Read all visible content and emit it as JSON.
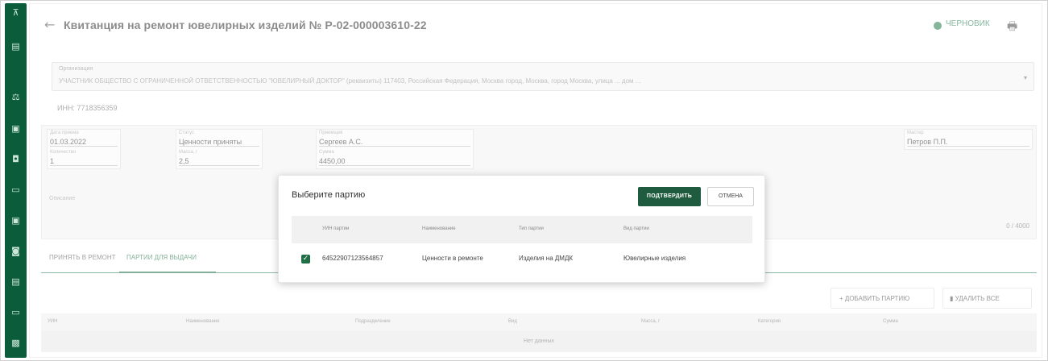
{
  "rail": {
    "icons": [
      "filter-icon",
      "list-icon",
      "scale-icon",
      "doc-icon",
      "box-icon",
      "folder-icon",
      "file-icon",
      "briefcase-icon",
      "table-icon",
      "window-icon",
      "card-icon"
    ],
    "glyphs": [
      "⊼",
      "▤",
      "⚖",
      "▣",
      "◘",
      "▭",
      "▣",
      "◙",
      "▤",
      "▭",
      "▩"
    ]
  },
  "header": {
    "back_glyph": "←",
    "title": "Квитанция на ремонт ювелирных изделий № Р-02-000003610-22",
    "status": "ЧЕРНОВИК",
    "status_color": "#1f7a4c",
    "print_glyph": "🖶"
  },
  "org": {
    "label": "Организация",
    "value": "УЧАСТНИК ОБЩЕСТВО С ОГРАНИЧЕННОЙ ОТВЕТСТВЕННОСТЬЮ \"ЮВЕЛИРНЫЙ ДОКТОР\" (реквизиты) 117403, Российская Федерация, Москва город, Москва, город Москва, улица ... дом ...",
    "caret": "▾",
    "inn": "ИНН: 7718356359"
  },
  "fields": [
    {
      "label": "Дата приема",
      "value": "01.03.2022"
    },
    {
      "label": "Статус",
      "value": "Ценности приняты"
    },
    {
      "label": "Приемщик",
      "value": "Сергеев А.С."
    },
    {
      "label": "Мастер",
      "value": "Петров П.П."
    },
    {
      "label": "Количество",
      "value": "1"
    },
    {
      "label": "Масса, г",
      "value": "2,5"
    },
    {
      "label": "Сумма",
      "value": "4450,00"
    }
  ],
  "comment": {
    "label": "Описание",
    "counter": "0 / 4000"
  },
  "tabs": [
    {
      "label": "ПРИНЯТЬ В РЕМОНТ"
    },
    {
      "label": "ПАРТИИ ДЛЯ ВЫДАЧИ"
    }
  ],
  "actions": {
    "add_label": "+ ДОБАВИТЬ ПАРТИЮ",
    "delete_label": "▮ УДАЛИТЬ ВСЕ"
  },
  "grid": {
    "columns": [
      "УИН",
      "Наименование",
      "Подразделение",
      "Вид",
      "Масса, г",
      "Категория",
      "Сумма"
    ],
    "empty": "Нет данных"
  },
  "modal": {
    "title": "Выберите партию",
    "confirm": "ПОДТВЕРДИТЬ",
    "cancel": "ОТМЕНА",
    "columns": [
      "УИН партии",
      "Наименование",
      "Тип партии",
      "Вид партии"
    ],
    "row": {
      "checked_glyph": "✓",
      "uin": "64522907123564857",
      "name": "Ценности в ремонте",
      "type": "Изделия на ДМДК",
      "kind": "Ювелирные изделия"
    },
    "accent": "#1f5b3e"
  }
}
